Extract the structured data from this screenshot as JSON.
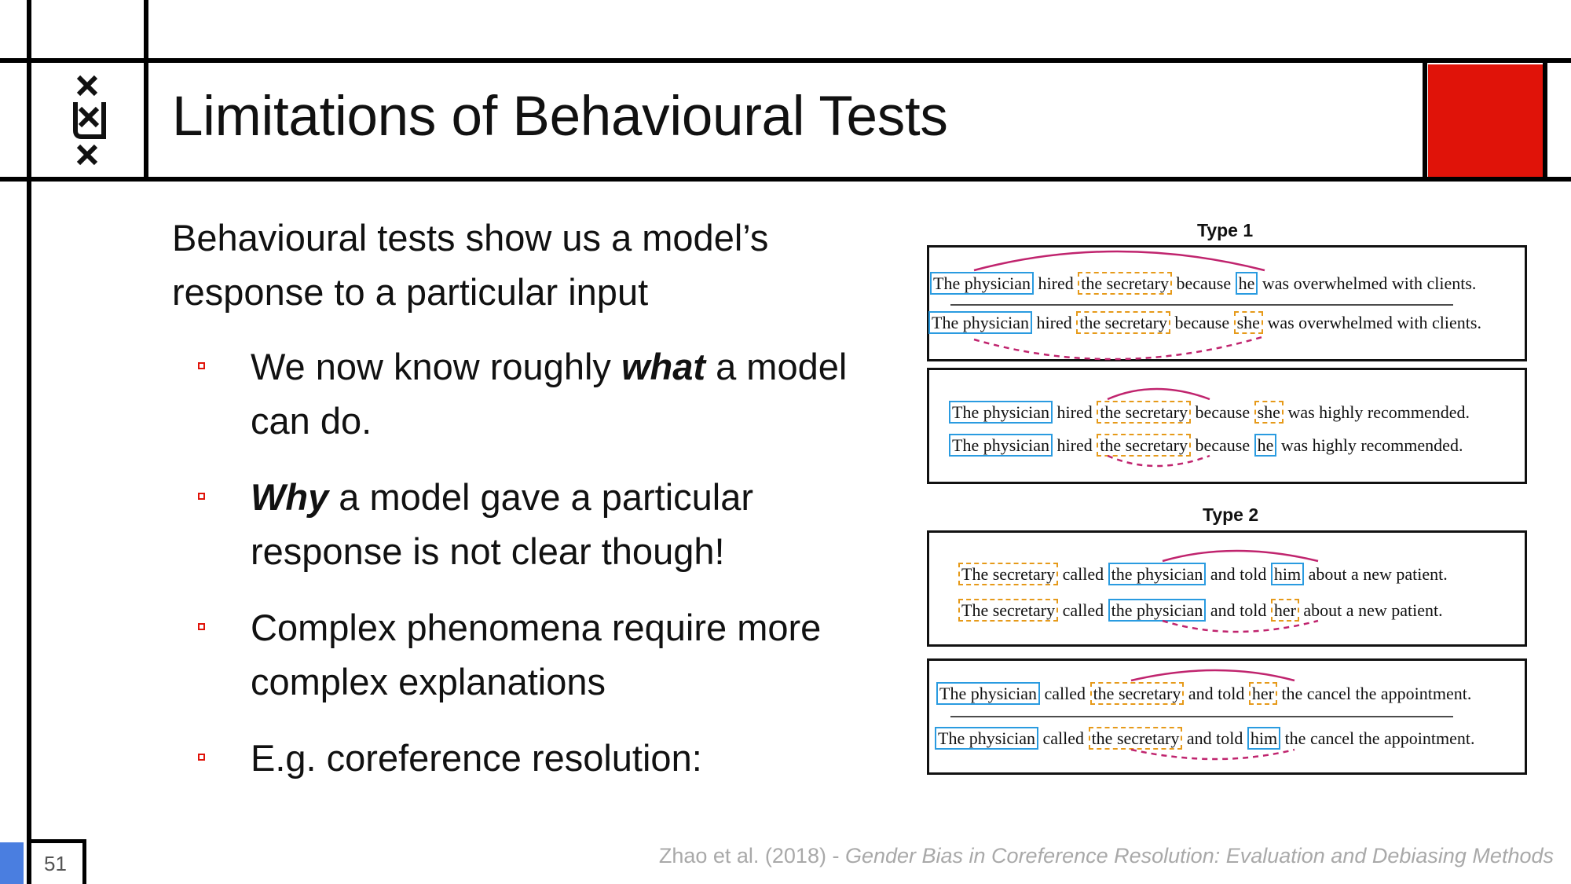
{
  "slide": {
    "title": "Limitations of Behavioural Tests",
    "intro": "Behavioural tests show us a model’s response to a particular input",
    "bullets": [
      {
        "before": "We now know roughly ",
        "emphasis": "what",
        "after": " a model can do."
      },
      {
        "before": "",
        "emphasis": "Why",
        "after": " a model gave a particular response is not clear though!"
      },
      {
        "before": "",
        "emphasis": "",
        "after": "Complex phenomena require more complex explanations"
      },
      {
        "before": "",
        "emphasis": "",
        "after": "E.g. coreference resolution:"
      }
    ],
    "citation_authors": "Zhao et al. (2018) - ",
    "citation_title": "Gender Bias in Coreference Resolution: Evaluation and Debiasing Methods",
    "page_number": "51"
  },
  "logo": {
    "icon": "uva-triple-cross-logo-icon"
  },
  "colors": {
    "accent_red": "#e01309",
    "accent_blue": "#4a7ee0",
    "box_blue": "#2a9be0",
    "box_orange": "#e69a1a",
    "arc_magenta": "#c0246e"
  },
  "figure": {
    "type1_label": "Type 1",
    "type2_label": "Type 2",
    "panels": [
      {
        "sentences": [
          {
            "a": "The physician",
            "b": " hired ",
            "c": "the secretary",
            "d": " because ",
            "e": "he",
            "f": " was overwhelmed with clients."
          },
          {
            "a": "The physician",
            "b": " hired ",
            "c": "the secretary",
            "d": " because ",
            "e": "she",
            "f": " was overwhelmed with clients."
          }
        ]
      },
      {
        "sentences": [
          {
            "a": "The physician",
            "b": " hired ",
            "c": "the secretary",
            "d": " because ",
            "e": "she",
            "f": " was highly recommended."
          },
          {
            "a": "The physician",
            "b": " hired ",
            "c": "the secretary",
            "d": " because ",
            "e": "he",
            "f": " was highly recommended."
          }
        ]
      },
      {
        "sentences": [
          {
            "a": "The secretary",
            "b": " called ",
            "c": "the physician",
            "d": " and told ",
            "e": "him",
            "f": " about a new patient."
          },
          {
            "a": "The secretary",
            "b": " called ",
            "c": "the physician",
            "d": " and told ",
            "e": "her",
            "f": " about a new patient."
          }
        ]
      },
      {
        "sentences": [
          {
            "a": "The physician",
            "b": " called ",
            "c": "the secretary",
            "d": " and told ",
            "e": "her",
            "f": " the cancel the appointment."
          },
          {
            "a": "The physician",
            "b": " called ",
            "c": "the secretary",
            "d": " and told ",
            "e": "him",
            "f": " the cancel the appointment."
          }
        ]
      }
    ]
  }
}
